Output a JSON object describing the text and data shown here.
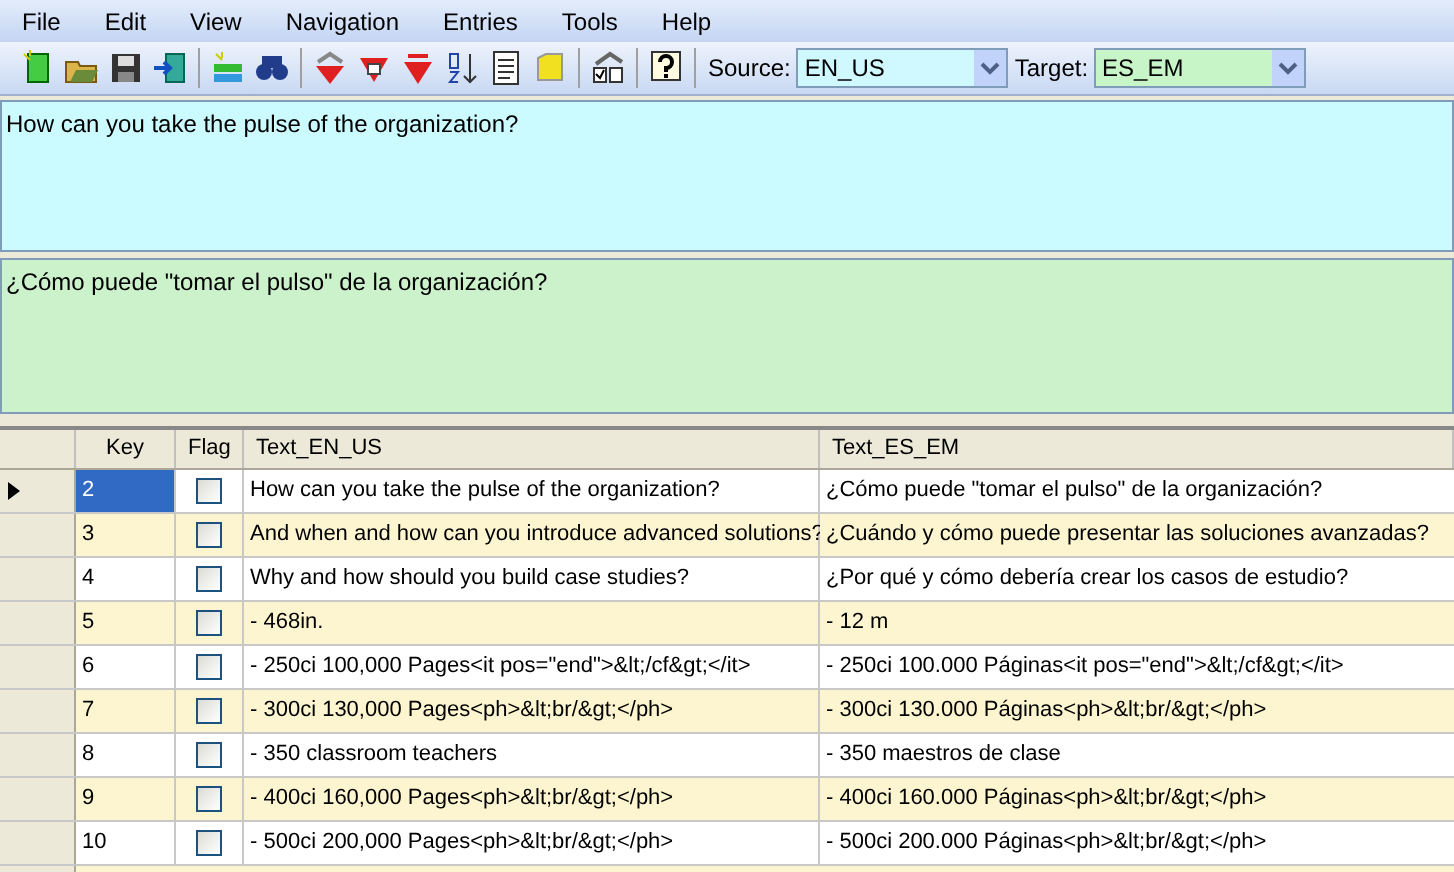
{
  "menu": [
    "File",
    "Edit",
    "View",
    "Navigation",
    "Entries",
    "Tools",
    "Help"
  ],
  "toolbar": {
    "source_label": "Source:",
    "source_value": "EN_US",
    "target_label": "Target:",
    "target_value": "ES_EM"
  },
  "source_text": "How can you take the pulse of the organization?",
  "target_text": "¿Cómo puede \"tomar el pulso\" de la organización?",
  "table": {
    "columns": [
      "Key",
      "Flag",
      "Text_EN_US",
      "Text_ES_EM"
    ],
    "rows": [
      {
        "key": "2",
        "flag": false,
        "selected": true,
        "source": "How can you take the pulse of the organization?",
        "target": "¿Cómo puede \"tomar el pulso\" de la organización?"
      },
      {
        "key": "3",
        "flag": false,
        "selected": false,
        "source": "And when and how can you introduce advanced solutions?",
        "target": "¿Cuándo y cómo puede presentar las soluciones avanzadas?"
      },
      {
        "key": "4",
        "flag": false,
        "selected": false,
        "source": "Why and how should you build case studies?",
        "target": "¿Por qué y cómo debería crear los casos de estudio?"
      },
      {
        "key": "5",
        "flag": false,
        "selected": false,
        "source": "- 468in.",
        "target": "- 12 m"
      },
      {
        "key": "6",
        "flag": false,
        "selected": false,
        "source": "- 250ci 100,000 Pages<it pos=\"end\">&lt;/cf&gt;</it>",
        "target": "- 250ci 100.000 Páginas<it pos=\"end\">&lt;/cf&gt;</it>"
      },
      {
        "key": "7",
        "flag": false,
        "selected": false,
        "source": "- 300ci 130,000 Pages<ph>&lt;br/&gt;</ph>",
        "target": "- 300ci 130.000 Páginas<ph>&lt;br/&gt;</ph>"
      },
      {
        "key": "8",
        "flag": false,
        "selected": false,
        "source": "- 350 classroom teachers",
        "target": "- 350 maestros de clase"
      },
      {
        "key": "9",
        "flag": false,
        "selected": false,
        "source": "- 400ci 160,000 Pages<ph>&lt;br/&gt;</ph>",
        "target": "- 400ci 160.000 Páginas<ph>&lt;br/&gt;</ph>"
      },
      {
        "key": "10",
        "flag": false,
        "selected": false,
        "source": "- 500ci 200,000 Pages<ph>&lt;br/&gt;</ph>",
        "target": "- 500ci 200.000 Páginas<ph>&lt;br/&gt;</ph>"
      }
    ]
  }
}
